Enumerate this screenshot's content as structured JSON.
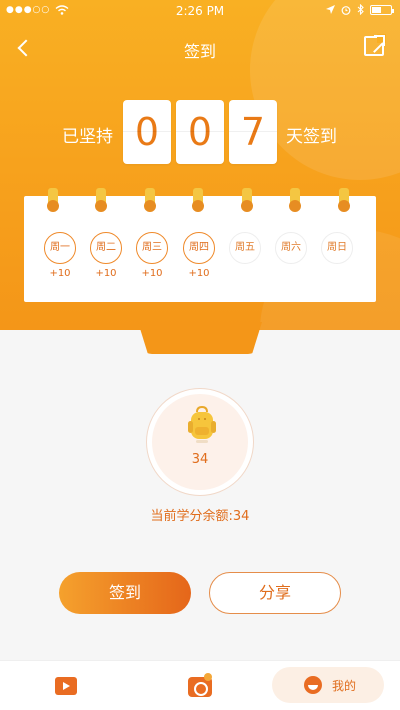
{
  "status_bar": {
    "signal": "●●●○○",
    "time": "2:26 PM"
  },
  "nav": {
    "title": "签到"
  },
  "streak": {
    "prefix": "已坚持",
    "digits": [
      "0",
      "0",
      "7"
    ],
    "suffix": "天签到"
  },
  "calendar": {
    "days": [
      {
        "label": "周一",
        "points": "+10",
        "checked": true
      },
      {
        "label": "周二",
        "points": "+10",
        "checked": true
      },
      {
        "label": "周三",
        "points": "+10",
        "checked": true
      },
      {
        "label": "周四",
        "points": "+10",
        "checked": true
      },
      {
        "label": "周五",
        "points": "",
        "checked": false
      },
      {
        "label": "周六",
        "points": "",
        "checked": false
      },
      {
        "label": "周日",
        "points": "",
        "checked": false
      }
    ]
  },
  "points": {
    "value": "34",
    "balance_text": "当前学分余额:34"
  },
  "actions": {
    "checkin_label": "签到",
    "share_label": "分享"
  },
  "tabbar": {
    "me_label": "我的"
  },
  "colors": {
    "accent": "#e96c22",
    "hero_start": "#f9b023",
    "hero_end": "#f49618",
    "ring_pin": "#f4c642"
  },
  "icons": [
    "back-icon",
    "share-icon",
    "wifi-icon",
    "location-icon",
    "alarm-icon",
    "bluetooth-icon",
    "battery-icon",
    "backpack-icon",
    "video-icon",
    "camera-icon",
    "face-icon"
  ]
}
